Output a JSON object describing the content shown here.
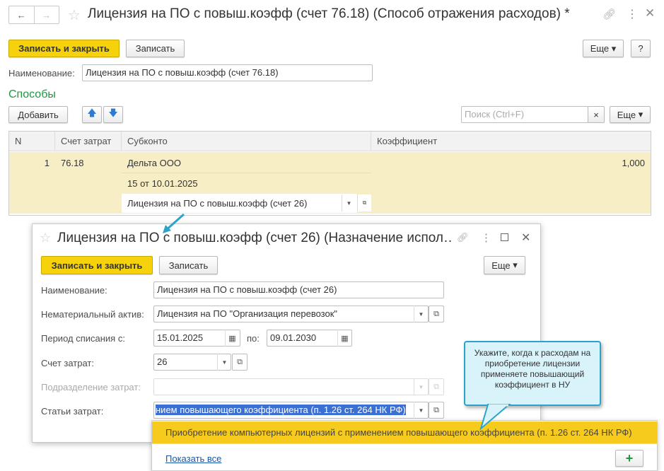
{
  "main": {
    "title": "Лицензия на ПО с повыш.коэфф (счет 76.18) (Способ отражения расходов) *",
    "save_close": "Записать и закрыть",
    "save": "Записать",
    "more": "Еще",
    "help": "?",
    "name_label": "Наименование:",
    "name_value": "Лицензия на ПО с повыш.коэфф (счет 76.18)",
    "section": "Способы",
    "add": "Добавить",
    "search_placeholder": "Поиск (Ctrl+F)",
    "search_clear": "×",
    "columns": [
      "N",
      "Счет затрат",
      "Субконто",
      "Коэффициент"
    ],
    "row": {
      "n": "1",
      "account": "76.18",
      "sub1": "Дельта ООО",
      "sub2": "15 от 10.01.2025",
      "sub3": "Лицензия на ПО с повыш.коэфф (счет 26)",
      "coef": "1,000"
    }
  },
  "dialog": {
    "title": "Лицензия на ПО с повыш.коэфф (счет 26) (Назначение испол…",
    "save_close": "Записать и закрыть",
    "save": "Записать",
    "more": "Еще",
    "name_label": "Наименование:",
    "name_value": "Лицензия на ПО с повыш.коэфф (счет 26)",
    "asset_label": "Нематериальный актив:",
    "asset_value": "Лицензия на ПО \"Организация перевозок\"",
    "period_label": "Период списания с:",
    "period_from": "15.01.2025",
    "period_to_label": "по:",
    "period_to": "09.01.2030",
    "account_label": "Счет затрат:",
    "account_value": "26",
    "dept_label": "Подразделение затрат:",
    "expense_label": "Статьи затрат:",
    "expense_value": "нием повышающего коэффициента (п. 1.26 ст. 264 НК РФ)"
  },
  "dropdown": {
    "option": "Приобретение компьютерных лицензий с применением повышающего коэффициента (п. 1.26 ст. 264 НК РФ)",
    "show_all": "Показать все",
    "add": "+"
  },
  "callout": {
    "text": "Укажите, когда к расходам на приобретение лицензии применяете повышающий коэффициент в НУ"
  }
}
